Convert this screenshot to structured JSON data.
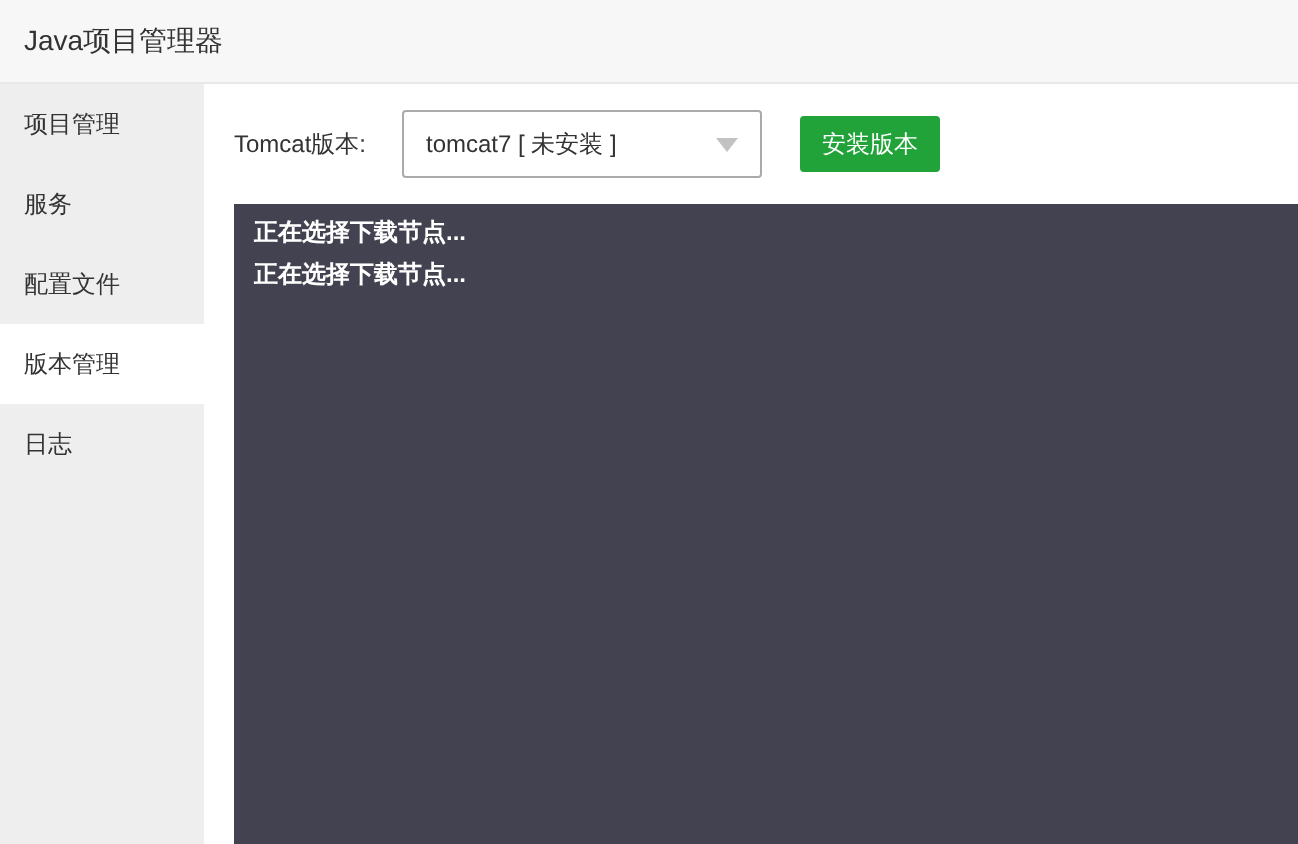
{
  "window": {
    "title": "Java项目管理器"
  },
  "sidebar": {
    "items": [
      {
        "label": "项目管理",
        "selected": false
      },
      {
        "label": "服务",
        "selected": false
      },
      {
        "label": "配置文件",
        "selected": false
      },
      {
        "label": "版本管理",
        "selected": true
      },
      {
        "label": "日志",
        "selected": false
      }
    ]
  },
  "version_form": {
    "label": "Tomcat版本:",
    "select_value": "tomcat7 [ 未安装 ]",
    "button": "安装版本"
  },
  "console": {
    "lines": [
      "正在选择下载节点...",
      "正在选择下载节点..."
    ]
  }
}
